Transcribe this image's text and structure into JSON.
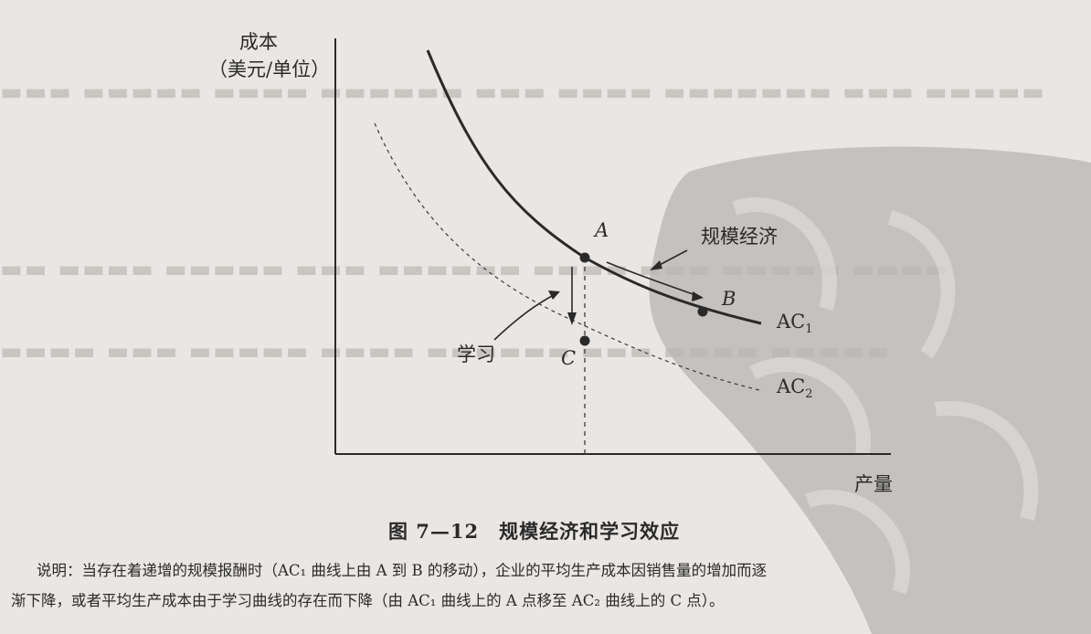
{
  "figure": {
    "y_axis_label_line1": "成本",
    "y_axis_label_line2": "（美元/单位）",
    "x_axis_label": "产量",
    "label_a": "A",
    "label_b": "B",
    "label_c": "C",
    "label_scale": "规模经济",
    "label_learning": "学习",
    "label_ac1": "AC",
    "label_ac1_sub": "1",
    "label_ac2": "AC",
    "label_ac2_sub": "2"
  },
  "caption": "图 7—12　规模经济和学习效应",
  "description_line1": "说明：当存在着递增的规模报酬时（AC₁ 曲线上由 A 到 B 的移动），企业的平均生产成本因销售量的增加而逐",
  "description_line2": "渐下降，或者平均生产成本由于学习曲线的存在而下降（由 AC₁ 曲线上的 A 点移至 AC₂ 曲线上的 C 点）。",
  "colors": {
    "paper": "#e9e6e3",
    "ink": "#2a2a2a",
    "stamp": "#b7b4b1",
    "bleed_text": "#c9c5c1"
  }
}
